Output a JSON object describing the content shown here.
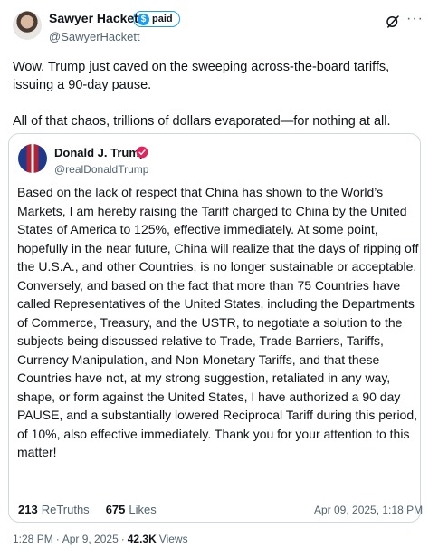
{
  "tweet": {
    "author_name": "Sawyer Hackett",
    "paid_label": "paid",
    "paid_symbol": "$",
    "handle": "@SawyerHackett",
    "paragraph_1": "Wow. Trump just caved on the sweeping across-the-board tariffs, issuing a 90-day pause.",
    "paragraph_2": "All of that chaos, trillions of dollars evaporated—for nothing at all.",
    "time": "1:28 PM",
    "date": "Apr 9, 2025",
    "views_count": "42.3K",
    "views_label": "Views",
    "separator": "·"
  },
  "quote": {
    "author_name": "Donald J. Trump",
    "handle": "@realDonaldTrump",
    "text": "Based on the lack of respect that China has shown to the World’s Markets, I am hereby raising the Tariff charged to China by the United States of America to 125%, effective immediately. At some point, hopefully in the near future, China will realize that the days of ripping off the U.S.A., and other Countries, is no longer sustainable or acceptable. Conversely, and based on the fact that more than 75 Countries have called Representatives of the United States, including the Departments of Commerce, Treasury, and the USTR, to negotiate a solution to the subjects being discussed relative to Trade, Trade Barriers, Tariffs, Currency Manipulation, and Non Monetary Tariffs, and that these Countries have not, at my strong suggestion, retaliated in any way, shape, or form against the United States, I have authorized a 90 day PAUSE, and a substantially lowered Reciprocal Tariff during this period, of 10%, also effective immediately. Thank you for your attention to this matter!",
    "retruths_count": "213",
    "retruths_label": "ReTruths",
    "likes_count": "675",
    "likes_label": "Likes",
    "timestamp": "Apr 09, 2025, 1:18 PM"
  },
  "icons": {
    "grok": "grok-icon",
    "more": "more-options-icon",
    "verified": "verified-check-icon"
  },
  "colors": {
    "accent": "#1d9bf0",
    "verified_badge": "#e0245e",
    "secondary_text": "#536471",
    "border": "#cfd9de"
  },
  "more_glyph": "···"
}
